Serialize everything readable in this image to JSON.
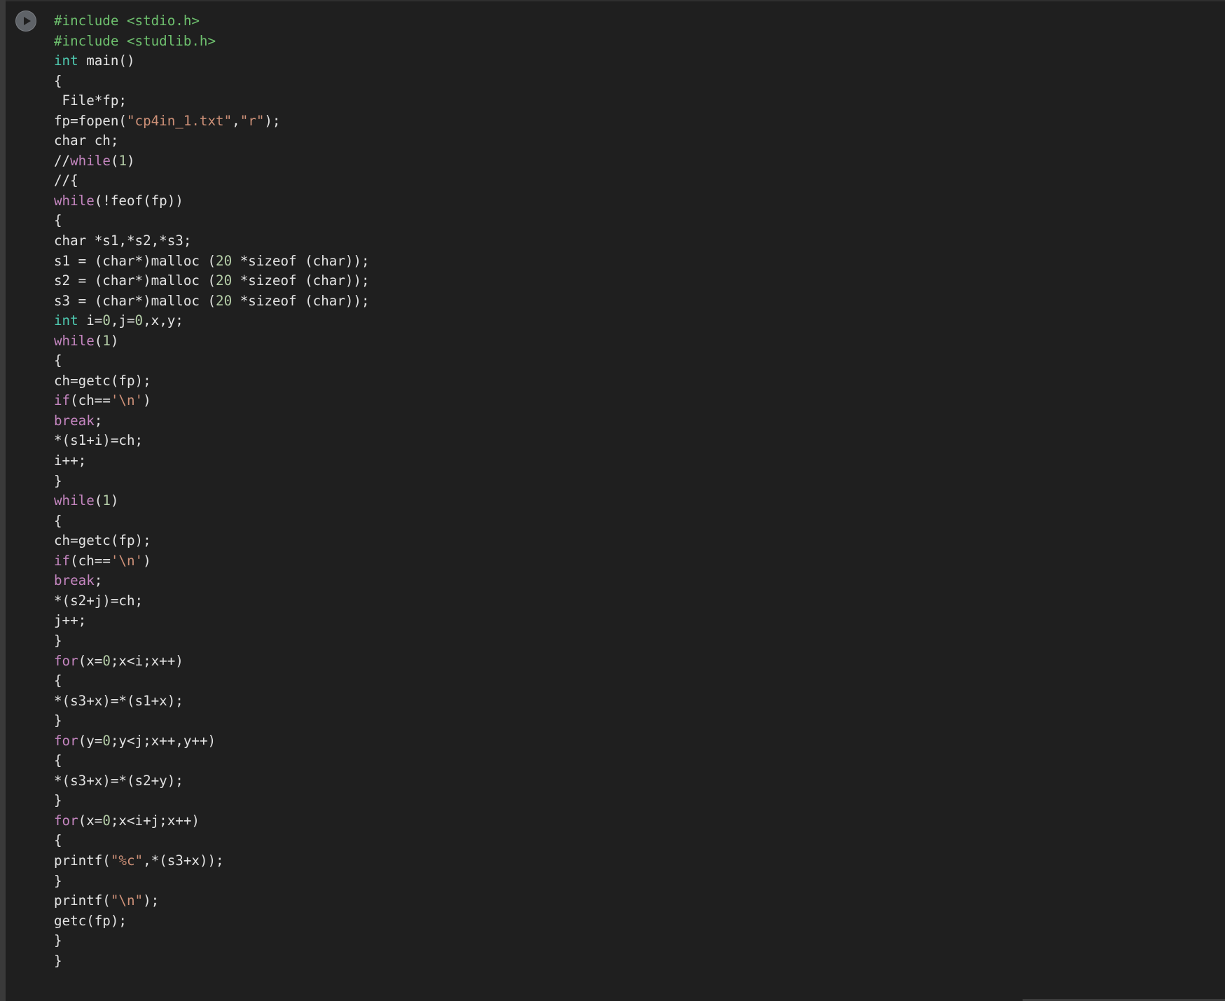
{
  "cell": {
    "run_button_icon": "play-icon",
    "language": "c",
    "lines": [
      [
        [
          "preproc",
          "#include <stdio.h>"
        ]
      ],
      [
        [
          "preproc",
          "#include <studlib.h>"
        ]
      ],
      [
        [
          "type",
          "int"
        ],
        [
          "plain",
          " main()"
        ]
      ],
      [
        [
          "plain",
          "{"
        ]
      ],
      [
        [
          "plain",
          " File*fp;"
        ]
      ],
      [
        [
          "plain",
          "fp=fopen("
        ],
        [
          "string",
          "\"cp4in_1.txt\""
        ],
        [
          "plain",
          ","
        ],
        [
          "string",
          "\"r\""
        ],
        [
          "plain",
          ");"
        ]
      ],
      [
        [
          "plain",
          "char ch;"
        ]
      ],
      [
        [
          "plain",
          "//"
        ],
        [
          "keyword",
          "while"
        ],
        [
          "plain",
          "("
        ],
        [
          "number",
          "1"
        ],
        [
          "plain",
          ")"
        ]
      ],
      [
        [
          "plain",
          "//{"
        ]
      ],
      [
        [
          "keyword",
          "while"
        ],
        [
          "plain",
          "(!feof(fp))"
        ]
      ],
      [
        [
          "plain",
          "{"
        ]
      ],
      [
        [
          "plain",
          "char *s1,*s2,*s3;"
        ]
      ],
      [
        [
          "plain",
          "s1 = (char*)malloc ("
        ],
        [
          "number",
          "20"
        ],
        [
          "plain",
          " *sizeof (char));"
        ]
      ],
      [
        [
          "plain",
          "s2 = (char*)malloc ("
        ],
        [
          "number",
          "20"
        ],
        [
          "plain",
          " *sizeof (char));"
        ]
      ],
      [
        [
          "plain",
          "s3 = (char*)malloc ("
        ],
        [
          "number",
          "20"
        ],
        [
          "plain",
          " *sizeof (char));"
        ]
      ],
      [
        [
          "type",
          "int"
        ],
        [
          "plain",
          " i="
        ],
        [
          "number",
          "0"
        ],
        [
          "plain",
          ",j="
        ],
        [
          "number",
          "0"
        ],
        [
          "plain",
          ",x,y;"
        ]
      ],
      [
        [
          "keyword",
          "while"
        ],
        [
          "plain",
          "("
        ],
        [
          "number",
          "1"
        ],
        [
          "plain",
          ")"
        ]
      ],
      [
        [
          "plain",
          "{"
        ]
      ],
      [
        [
          "plain",
          "ch=getc(fp);"
        ]
      ],
      [
        [
          "keyword",
          "if"
        ],
        [
          "plain",
          "(ch=="
        ],
        [
          "string",
          "'\\n'"
        ],
        [
          "plain",
          ")"
        ]
      ],
      [
        [
          "keyword",
          "break"
        ],
        [
          "plain",
          ";"
        ]
      ],
      [
        [
          "plain",
          "*(s1+i)=ch;"
        ]
      ],
      [
        [
          "plain",
          "i++;"
        ]
      ],
      [
        [
          "plain",
          "}"
        ]
      ],
      [
        [
          "keyword",
          "while"
        ],
        [
          "plain",
          "("
        ],
        [
          "number",
          "1"
        ],
        [
          "plain",
          ")"
        ]
      ],
      [
        [
          "plain",
          "{"
        ]
      ],
      [
        [
          "plain",
          "ch=getc(fp);"
        ]
      ],
      [
        [
          "keyword",
          "if"
        ],
        [
          "plain",
          "(ch=="
        ],
        [
          "string",
          "'\\n'"
        ],
        [
          "plain",
          ")"
        ]
      ],
      [
        [
          "keyword",
          "break"
        ],
        [
          "plain",
          ";"
        ]
      ],
      [
        [
          "plain",
          "*(s2+j)=ch;"
        ]
      ],
      [
        [
          "plain",
          "j++;"
        ]
      ],
      [
        [
          "plain",
          "}"
        ]
      ],
      [
        [
          "keyword",
          "for"
        ],
        [
          "plain",
          "(x="
        ],
        [
          "number",
          "0"
        ],
        [
          "plain",
          ";x<i;x++)"
        ]
      ],
      [
        [
          "plain",
          "{"
        ]
      ],
      [
        [
          "plain",
          "*(s3+x)=*(s1+x);"
        ]
      ],
      [
        [
          "plain",
          "}"
        ]
      ],
      [
        [
          "keyword",
          "for"
        ],
        [
          "plain",
          "(y="
        ],
        [
          "number",
          "0"
        ],
        [
          "plain",
          ";y<j;x++,y++)"
        ]
      ],
      [
        [
          "plain",
          "{"
        ]
      ],
      [
        [
          "plain",
          "*(s3+x)=*(s2+y);"
        ]
      ],
      [
        [
          "plain",
          "}"
        ]
      ],
      [
        [
          "keyword",
          "for"
        ],
        [
          "plain",
          "(x="
        ],
        [
          "number",
          "0"
        ],
        [
          "plain",
          ";x<i+j;x++)"
        ]
      ],
      [
        [
          "plain",
          "{"
        ]
      ],
      [
        [
          "plain",
          "printf("
        ],
        [
          "string",
          "\"%c\""
        ],
        [
          "plain",
          ",*(s3+x));"
        ]
      ],
      [
        [
          "plain",
          "}"
        ]
      ],
      [
        [
          "plain",
          "printf("
        ],
        [
          "string",
          "\"\\n\""
        ],
        [
          "plain",
          ");"
        ]
      ],
      [
        [
          "plain",
          "getc(fp);"
        ]
      ],
      [
        [
          "plain",
          "}"
        ]
      ],
      [
        [
          "plain",
          "}"
        ]
      ]
    ]
  },
  "colors": {
    "background": "#1f1f1f",
    "preproc": "#6ec06e",
    "type": "#4ec9b0",
    "keyword": "#c586c0",
    "string": "#ce9178",
    "number": "#b5cea8",
    "plain": "#e3e3e3"
  }
}
